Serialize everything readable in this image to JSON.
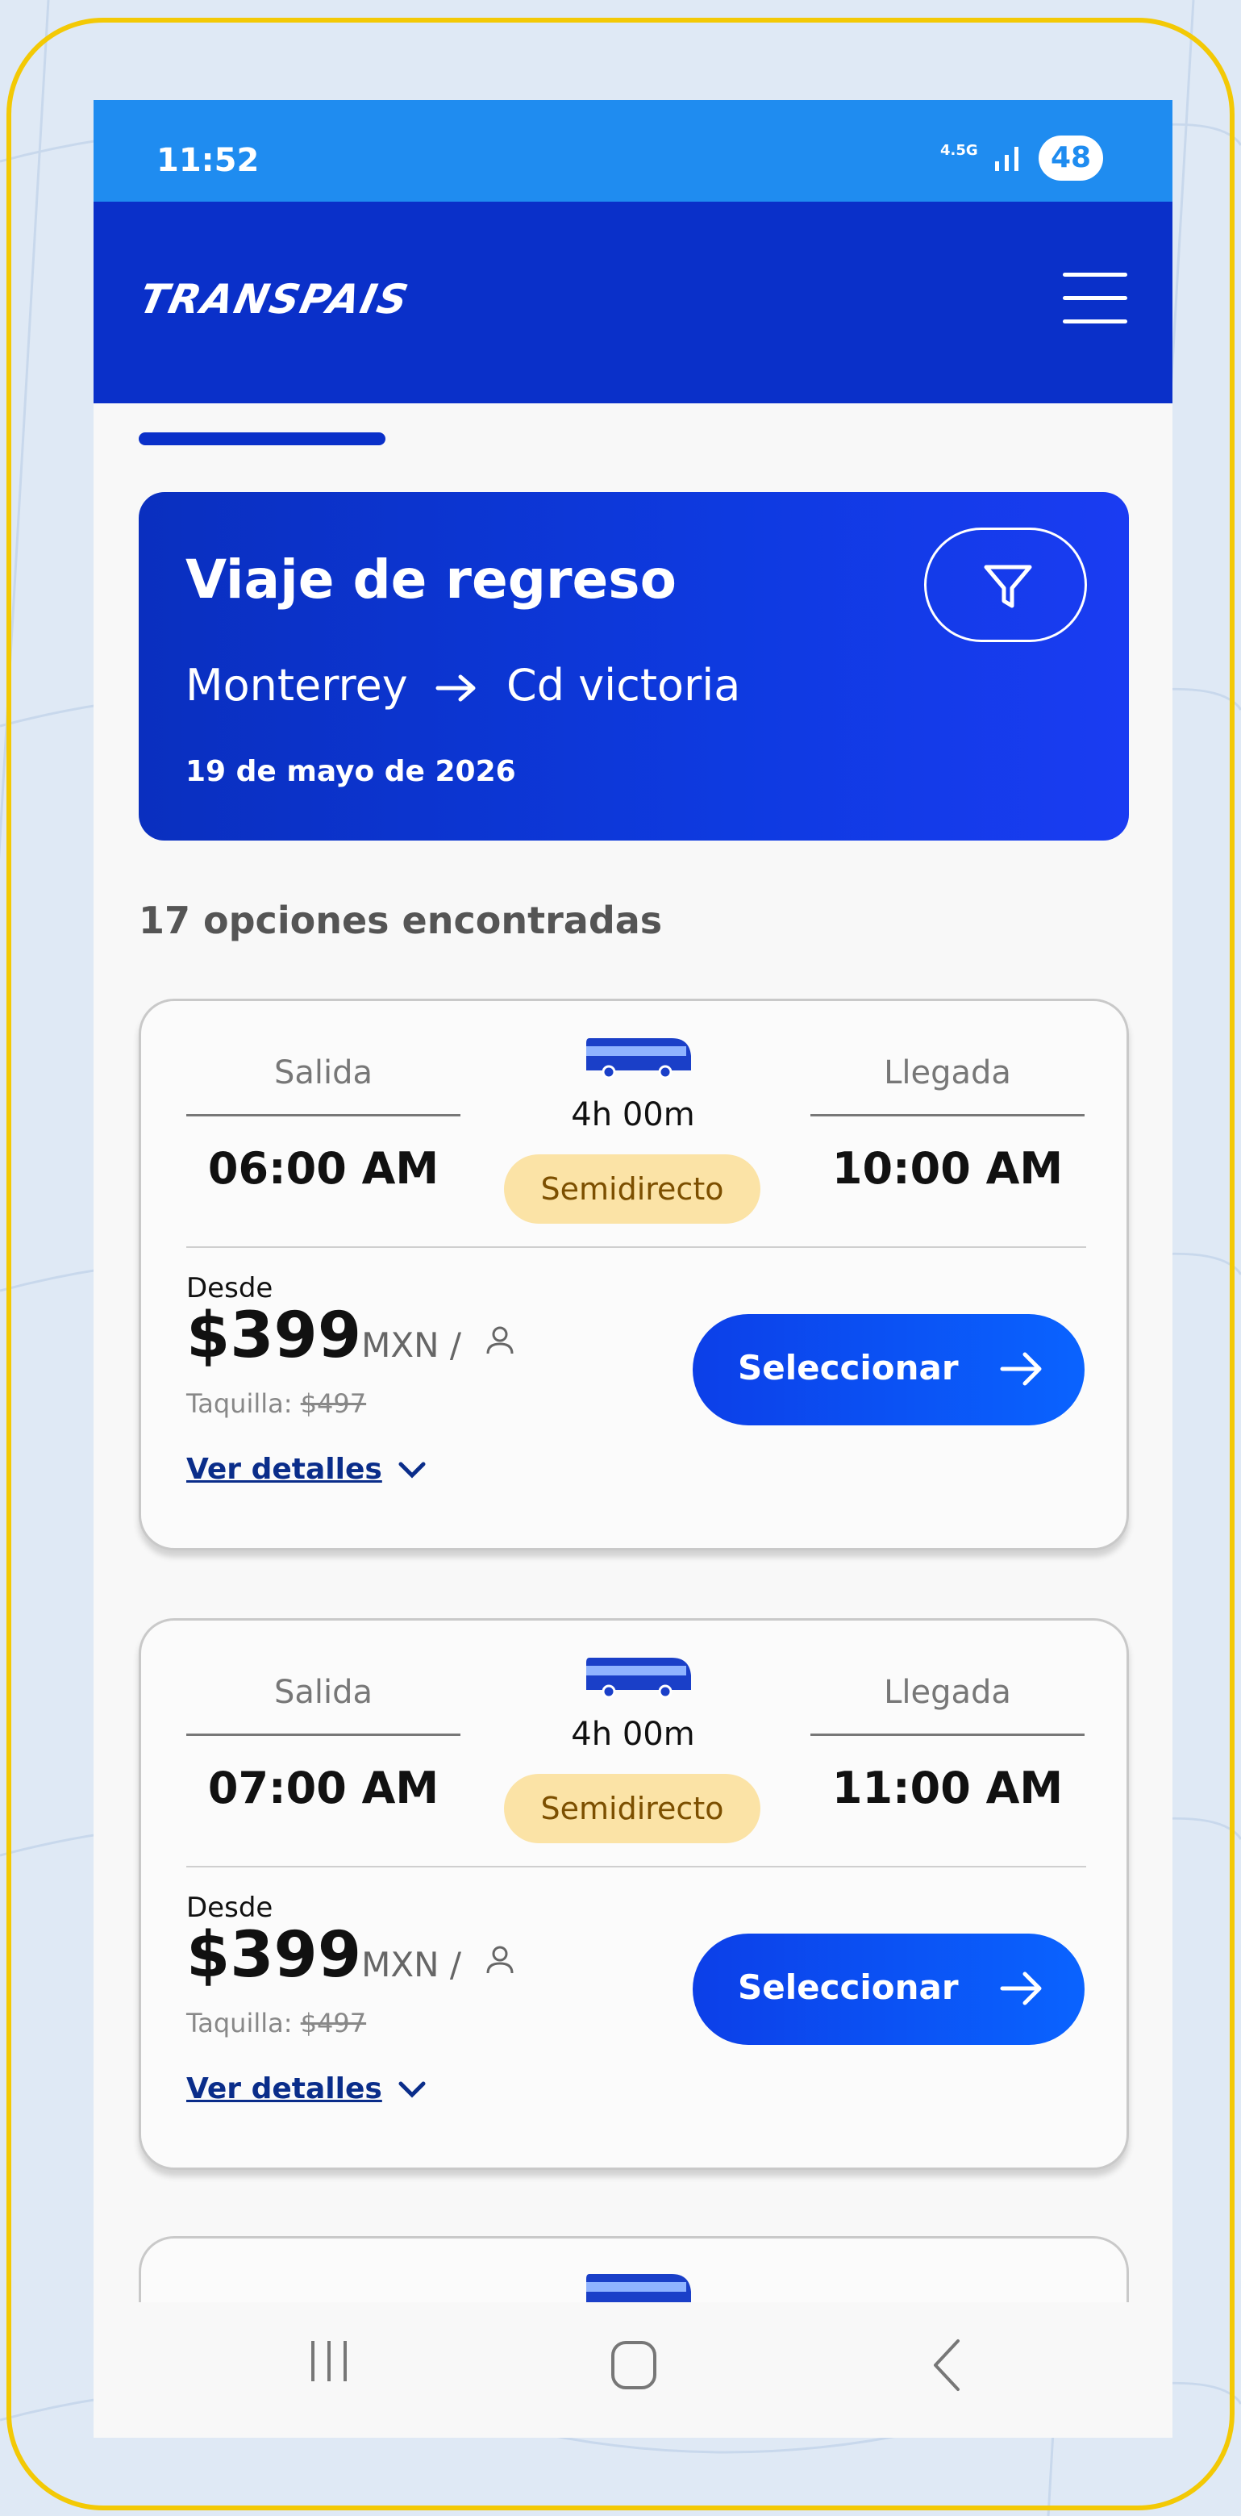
{
  "status_bar": {
    "time": "11:52",
    "network": "4.5G",
    "battery": "48"
  },
  "app_bar": {
    "logo": "TRANSPAIS"
  },
  "trip_header": {
    "title": "Viaje de regreso",
    "origin": "Monterrey",
    "destination": "Cd victoria",
    "date": "19 de mayo de 2026"
  },
  "results": {
    "count_text": "17 opciones encontradas"
  },
  "labels": {
    "departure": "Salida",
    "arrival": "Llegada",
    "from": "Desde",
    "currency": "MXN /",
    "box_office": "Taquilla:",
    "select": "Seleccionar",
    "details": "Ver detalles"
  },
  "trips": [
    {
      "departure_time": "06:00 AM",
      "arrival_time": "10:00 AM",
      "duration": "4h 00m",
      "service": "Semidirecto",
      "price": "$399",
      "box_office_price": "$497"
    },
    {
      "departure_time": "07:00 AM",
      "arrival_time": "11:00 AM",
      "duration": "4h 00m",
      "service": "Semidirecto",
      "price": "$399",
      "box_office_price": "$497"
    }
  ],
  "colors": {
    "brand_blue": "#0a30c9",
    "status_blue": "#1f8cf0",
    "badge_bg": "#fbe3a6",
    "frame_yellow": "#f3c905"
  }
}
